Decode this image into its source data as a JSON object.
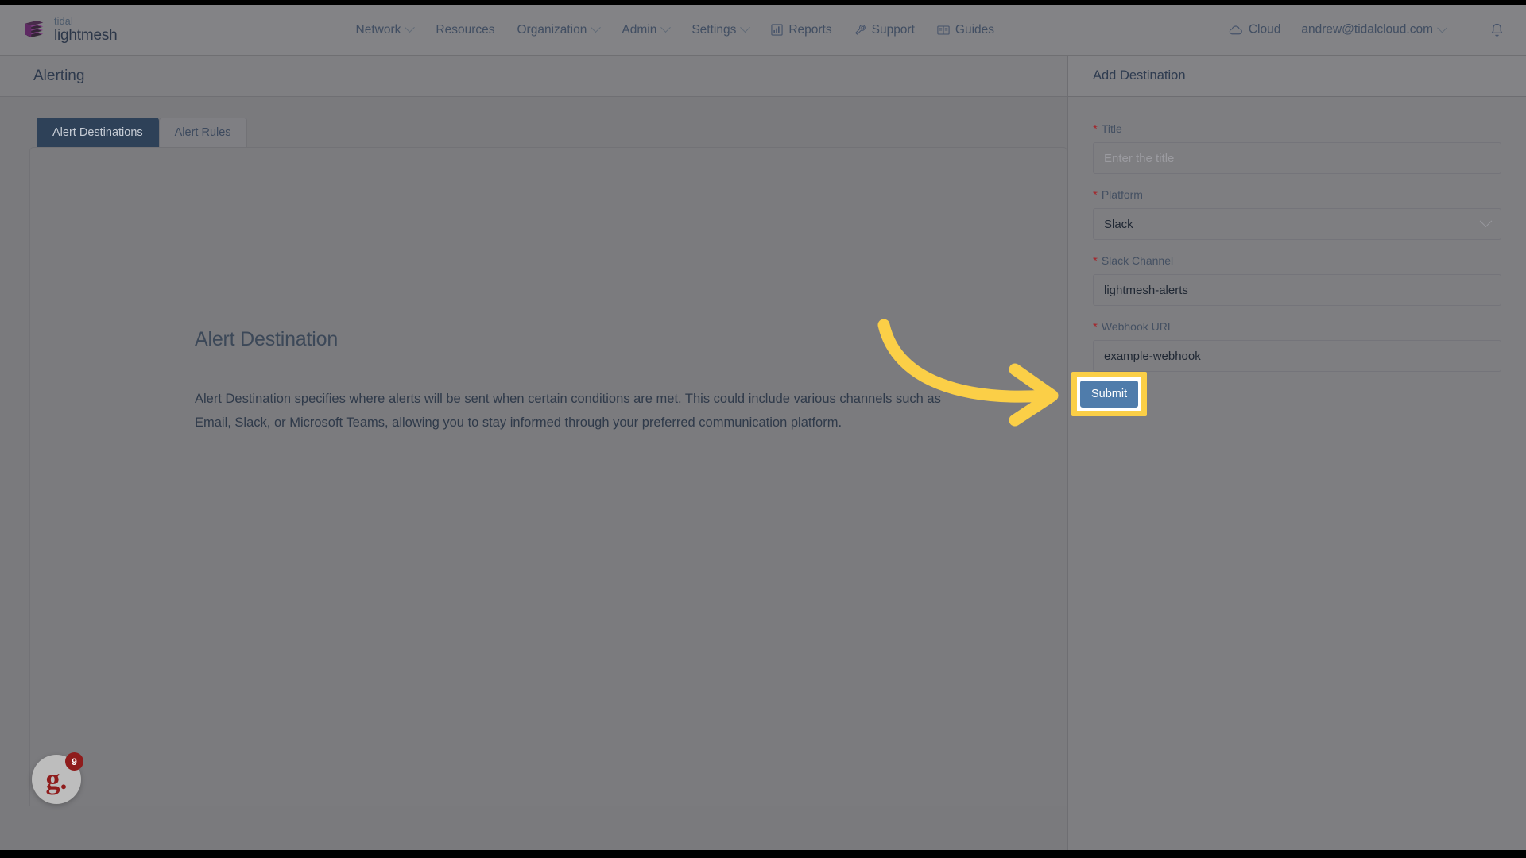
{
  "brand": {
    "top": "tidal",
    "bottom": "lightmesh",
    "logo_icon": "layered-stack-icon"
  },
  "nav": {
    "items": [
      {
        "label": "Network",
        "has_caret": true
      },
      {
        "label": "Resources",
        "has_caret": false
      },
      {
        "label": "Organization",
        "has_caret": true
      },
      {
        "label": "Admin",
        "has_caret": true
      },
      {
        "label": "Settings",
        "has_caret": true
      },
      {
        "label": "Reports",
        "has_caret": false,
        "icon": "bar-chart-icon"
      },
      {
        "label": "Support",
        "has_caret": false,
        "icon": "wrench-icon"
      },
      {
        "label": "Guides",
        "has_caret": false,
        "icon": "book-icon"
      }
    ],
    "right": {
      "cloud_label": "Cloud",
      "cloud_icon": "cloud-icon",
      "account": "andrew@tidalcloud.com",
      "notification_icon": "bell-icon"
    }
  },
  "page": {
    "title": "Alerting"
  },
  "tabs": [
    {
      "label": "Alert Destinations",
      "active": true
    },
    {
      "label": "Alert Rules",
      "active": false
    }
  ],
  "card": {
    "heading": "Alert Destination",
    "body": "Alert Destination specifies where alerts will be sent when certain conditions are met. This could include various channels such as Email, Slack, or Microsoft Teams, allowing you to stay informed through your preferred communication platform."
  },
  "drawer": {
    "title": "Add Destination",
    "fields": [
      {
        "label": "Title",
        "required": true,
        "value": "",
        "placeholder": "Enter the title",
        "type": "text"
      },
      {
        "label": "Platform",
        "required": true,
        "value": "Slack",
        "placeholder": "",
        "type": "select"
      },
      {
        "label": "Slack Channel",
        "required": true,
        "value": "lightmesh-alerts",
        "placeholder": "",
        "type": "text"
      },
      {
        "label": "Webhook URL",
        "required": true,
        "value": "example-webhook",
        "placeholder": "",
        "type": "text"
      }
    ],
    "submit_label": "Submit"
  },
  "help_widget": {
    "glyph": "g.",
    "badge_count": "9"
  },
  "annotation": {
    "arrow_color": "#fbcf47",
    "highlight_color": "#fbcf47",
    "target": "submit-button"
  },
  "colors": {
    "accent_blue": "#4f7cab",
    "tab_active": "#2e4158",
    "required_star": "#a4262c",
    "highlight_yellow": "#fbcf47"
  }
}
